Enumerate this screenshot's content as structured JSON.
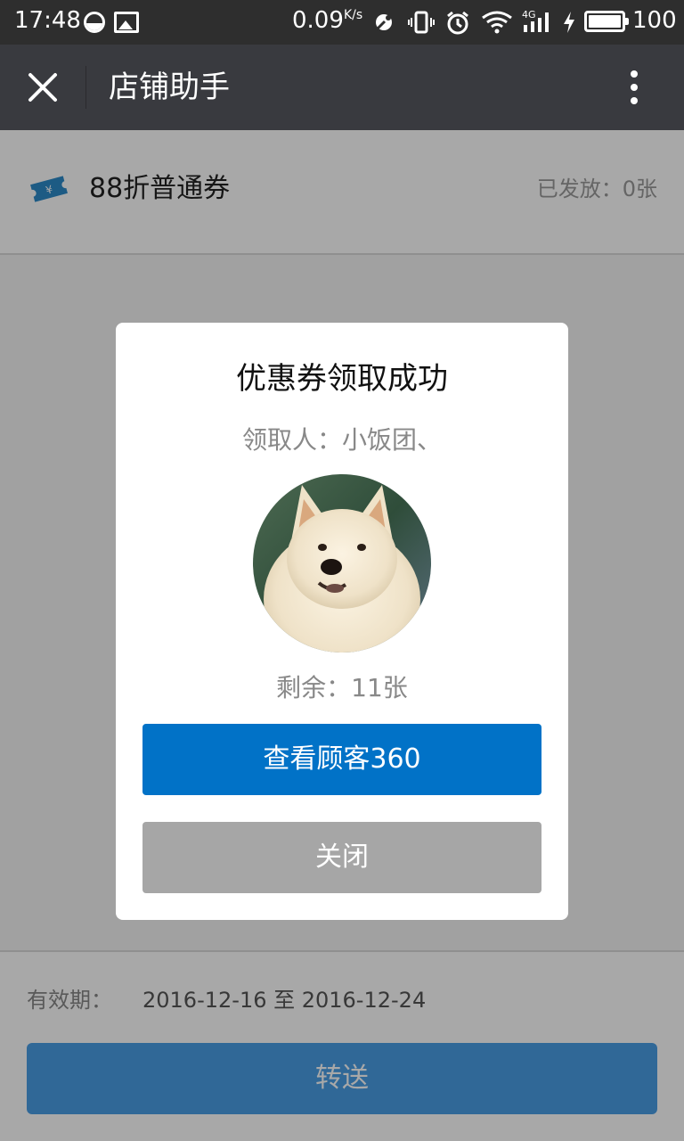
{
  "status_bar": {
    "time": "17:48",
    "net_speed": "0.09",
    "net_speed_unit": "K/s",
    "network_type": "4G",
    "battery_level": "100",
    "icons": [
      "dnd-icon",
      "gallery-icon",
      "satellite-icon",
      "vibrate-icon",
      "alarm-icon",
      "wifi-icon",
      "signal-icon",
      "charging-icon",
      "battery-icon"
    ]
  },
  "header": {
    "title": "店铺助手",
    "close_icon": "close-icon",
    "more_icon": "more-vertical-icon"
  },
  "coupon": {
    "name": "88折普通券",
    "issued_text": "已发放：0张",
    "icon": "ticket-icon"
  },
  "validity": {
    "label": "有效期：",
    "range": "2016-12-16 至 2016-12-24"
  },
  "forward_button": {
    "label": "转送"
  },
  "dialog": {
    "title": "优惠券领取成功",
    "recipient": "领取人：小饭团、",
    "remaining": "剩余：11张",
    "primary_button": "查看顾客360",
    "close_button": "关闭",
    "avatar_icon": "dog-avatar"
  },
  "colors": {
    "status_bar_bg": "#2e2e2e",
    "title_bar_bg": "#393a3f",
    "primary_blue": "#0172c7",
    "forward_blue": "#4a9fe6",
    "close_gray": "#a6a6a6",
    "ticket_blue": "#2d8ac9"
  }
}
